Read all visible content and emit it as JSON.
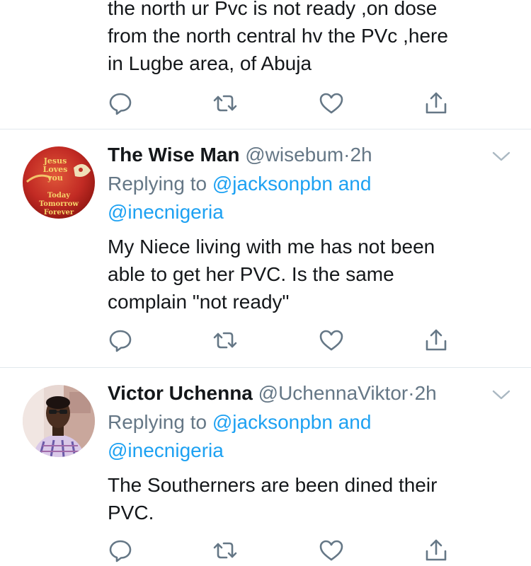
{
  "tweet0": {
    "text_lines": [
      "the north ur Pvc  is not ready  ,on dose",
      "from the north central hv the PVc  ,here",
      "in Lugbe area, of Abuja"
    ]
  },
  "tweet1": {
    "name": "The Wise Man",
    "handle": "@wisebum",
    "separator": "·",
    "time": "2h",
    "replying_prefix": "Replying to ",
    "replying_to_1": "@jacksonpbn",
    "replying_conj": " and",
    "replying_to_2": "@inecnigeria",
    "text_lines": [
      "My Niece living with me has not been",
      "able to get her PVC. Is the same",
      "complain \"not ready\""
    ],
    "avatar": {
      "line1": "Jesus",
      "line2": "Loves",
      "line3": "you",
      "line4": "Today",
      "line5": "Tomorrow",
      "line6": "Forever"
    }
  },
  "tweet2": {
    "name": "Victor Uchenna",
    "handle": "@UchennaViktor",
    "separator": "·",
    "time": "2h",
    "replying_prefix": "Replying to ",
    "replying_to_1": "@jacksonpbn",
    "replying_conj": " and",
    "replying_to_2": "@inecnigeria",
    "text_lines": [
      "The Southerners are been dined their",
      "PVC."
    ]
  },
  "icons": {
    "reply": "reply-icon",
    "retweet": "retweet-icon",
    "like": "heart-icon",
    "share": "share-icon",
    "menu": "chevron-down-icon"
  },
  "colors": {
    "text": "#14171a",
    "secondary": "#657786",
    "link": "#1da1f2",
    "divider": "#e1e8ed"
  }
}
